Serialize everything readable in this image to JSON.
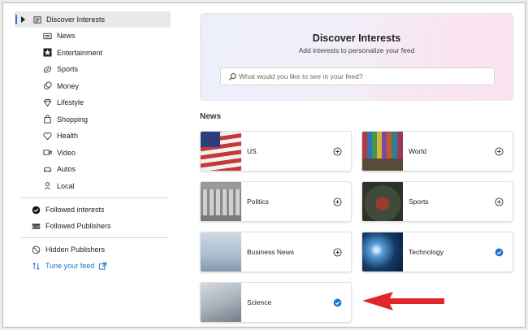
{
  "sidebar": {
    "top_item": {
      "label": "Discover Interests",
      "icon": "newspaper-icon"
    },
    "sub_items": [
      {
        "label": "News",
        "icon": "news-icon"
      },
      {
        "label": "Entertainment",
        "icon": "star-icon"
      },
      {
        "label": "Sports",
        "icon": "football-icon"
      },
      {
        "label": "Money",
        "icon": "money-icon"
      },
      {
        "label": "Lifestyle",
        "icon": "diamond-icon"
      },
      {
        "label": "Shopping",
        "icon": "shopping-bag-icon"
      },
      {
        "label": "Health",
        "icon": "heart-icon"
      },
      {
        "label": "Video",
        "icon": "video-icon"
      },
      {
        "label": "Autos",
        "icon": "car-icon"
      },
      {
        "label": "Local",
        "icon": "location-pin-icon"
      }
    ],
    "followed_interests": "Followed interests",
    "followed_publishers": "Followed Publishers",
    "hidden_publishers": "Hidden Publishers",
    "tune_feed": "Tune your feed"
  },
  "hero": {
    "title": "Discover Interests",
    "subtitle": "Add interests to personalize your feed",
    "search_placeholder": "What would you like to see in your feed?"
  },
  "section": {
    "title": "News"
  },
  "cards": [
    {
      "label": "US",
      "followed": false
    },
    {
      "label": "World",
      "followed": false
    },
    {
      "label": "Politics",
      "followed": false
    },
    {
      "label": "Sports",
      "followed": false
    },
    {
      "label": "Business News",
      "followed": false
    },
    {
      "label": "Technology",
      "followed": true
    },
    {
      "label": "Science",
      "followed": true
    }
  ],
  "colors": {
    "accent": "#2a6ed6",
    "check": "#1d6fd0",
    "link": "#1d6fd0",
    "arrow": "#e0262a"
  }
}
